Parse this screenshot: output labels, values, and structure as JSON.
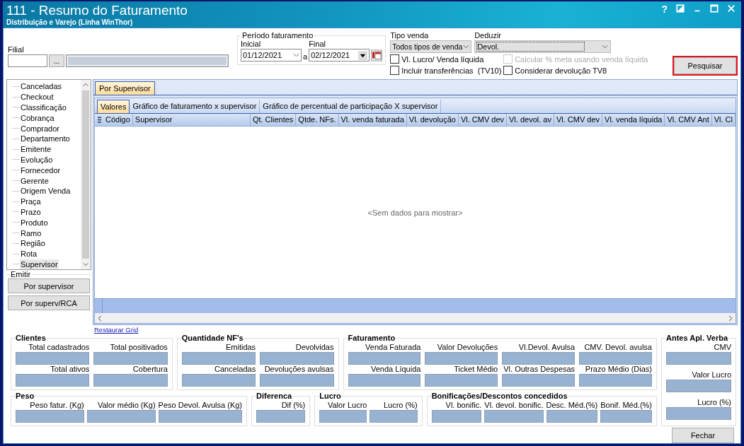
{
  "window": {
    "title": "111 - Resumo do Faturamento",
    "subtitle": "Distribuição e Varejo (Linha WinThor)",
    "help": "?"
  },
  "filters": {
    "filial_label": "Filial",
    "browse_button": "...",
    "period": {
      "title": "Período faturamento",
      "start_label": "Inicial",
      "start": "01/12/2021",
      "separator": "a",
      "end_label": "Final",
      "end": "02/12/2021"
    },
    "tipo_venda": {
      "label": "Tipo venda",
      "value": "Todos tipos de venda"
    },
    "deduzir": {
      "label": "Deduzir",
      "value": "Devol."
    },
    "options": [
      {
        "label": "Vl. Lucro/ Venda líquida",
        "checked": false,
        "disabled": false
      },
      {
        "label": "Calcular % meta usando venda líquida",
        "checked": false,
        "disabled": true
      },
      {
        "label": "Incluir transferências  (TV10)",
        "checked": false,
        "disabled": false
      },
      {
        "label": "Considerar devolução TV8",
        "checked": false,
        "disabled": false
      }
    ],
    "search_button": {
      "label": "Pesquisar",
      "highlighted": true
    }
  },
  "sidebar": {
    "items": [
      {
        "label": "Canceladas",
        "selected": false
      },
      {
        "label": "Checkout",
        "selected": false
      },
      {
        "label": "Classificação",
        "selected": false
      },
      {
        "label": "Cobrança",
        "selected": false
      },
      {
        "label": "Comprador",
        "selected": false
      },
      {
        "label": "Departamento",
        "selected": false
      },
      {
        "label": "Emitente",
        "selected": false
      },
      {
        "label": "Evolução",
        "selected": false
      },
      {
        "label": "Fornecedor",
        "selected": false
      },
      {
        "label": "Gerente",
        "selected": false
      },
      {
        "label": "Origem Venda",
        "selected": false
      },
      {
        "label": "Praça",
        "selected": false
      },
      {
        "label": "Prazo",
        "selected": false
      },
      {
        "label": "Produto",
        "selected": false
      },
      {
        "label": "Ramo",
        "selected": false
      },
      {
        "label": "Região",
        "selected": false
      },
      {
        "label": "Rota",
        "selected": false
      },
      {
        "label": "Supervisor",
        "selected": true
      }
    ],
    "emitir": {
      "title": "Emitir",
      "buttons": [
        "Por supervisor",
        "Por superv/RCA"
      ]
    }
  },
  "grid": {
    "tabs": [
      {
        "label": "Por Supervisor",
        "selected": true
      }
    ],
    "subtabs": [
      {
        "label": "Valores",
        "selected": true
      },
      {
        "label": "Gráfico de faturamento x supervisor",
        "selected": false
      },
      {
        "label": "Gráfico de percentual de participação X supervisor",
        "selected": false
      }
    ],
    "columns": [
      "Código",
      "Supervisor",
      "Qt. Clientes",
      "Qtde. NFs.",
      "Vl. venda faturada",
      "Vl. devolução",
      "Vl. CMV dev",
      "Vl. devol. av",
      "Vl. CMV dev",
      "Vl. venda líquida",
      "Vl. CMV Ant",
      "Vl. Cl"
    ],
    "empty_message": "<Sem dados para mostrar>",
    "restore_link": "Restaurar Grid"
  },
  "summary": {
    "row_1": [
      {
        "title": "Clientes",
        "fields": [
          "Total cadastrados",
          "Total positivados",
          "Total ativos",
          "Cobertura"
        ]
      },
      {
        "title": "Quantidade NF's",
        "fields": [
          "Emitidas",
          "Devolvidas",
          "Canceladas",
          "Devoluções avulsas"
        ]
      },
      {
        "title": "Faturamento",
        "fields": [
          "Venda Faturada",
          "Valor Devoluções",
          "Vl.Devol. Avulsa",
          "CMV. Devol. avulsa",
          "Venda Líquida",
          "Ticket Médio",
          "Vl. Outras Despesas",
          "Prazo Médio (Dias)"
        ]
      }
    ],
    "row_2": [
      {
        "title": "Peso",
        "fields": [
          "Peso fatur. (Kg)",
          "Valor médio (Kg)",
          "Peso Devol. Avulsa (Kg)"
        ]
      },
      {
        "title": "Diferenca",
        "fields": [
          "Dif (%)"
        ]
      },
      {
        "title": "Lucro",
        "fields": [
          "Valor Lucro",
          "Lucro (%)"
        ]
      },
      {
        "title": "Bonificações/Descontos concedidos",
        "fields": [
          "Vl. bonific.",
          "Vl. devol. bonific.",
          "Desc. Méd.(%)",
          "Bonif. Méd.(%)"
        ]
      }
    ],
    "side": {
      "title": "Antes Apl. Verba",
      "fields": [
        "CMV",
        "Valor Lucro",
        "Lucro (%)"
      ]
    }
  },
  "close_button": "Fechar"
}
